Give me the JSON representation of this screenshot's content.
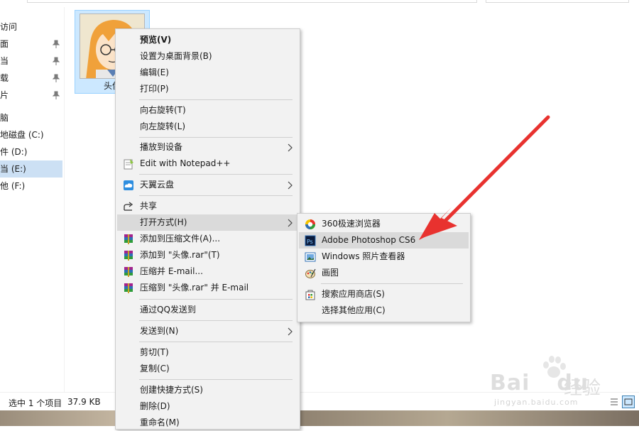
{
  "nav": {
    "items": [
      {
        "label": "访问",
        "pinned": false
      },
      {
        "label": "面",
        "pinned": true
      },
      {
        "label": "当",
        "pinned": true
      },
      {
        "label": "载",
        "pinned": true
      },
      {
        "label": "片",
        "pinned": true
      },
      {
        "label": "脑",
        "pinned": false
      },
      {
        "label": "地磁盘 (C:)",
        "pinned": false
      },
      {
        "label": "件 (D:)",
        "pinned": false
      },
      {
        "label": "当 (E:)",
        "pinned": false,
        "selected": true
      },
      {
        "label": "他 (F:)",
        "pinned": false
      }
    ]
  },
  "file": {
    "name": "头像"
  },
  "status": {
    "selection": "选中 1 个项目",
    "size": "37.9 KB"
  },
  "context_menu": {
    "items": [
      {
        "label": "预览(V)",
        "bold": true
      },
      {
        "label": "设置为桌面背景(B)"
      },
      {
        "label": "编辑(E)"
      },
      {
        "label": "打印(P)"
      },
      {
        "label": "向右旋转(T)"
      },
      {
        "label": "向左旋转(L)"
      },
      {
        "label": "播放到设备",
        "submenu": true
      },
      {
        "label": "Edit with Notepad++",
        "icon": "notepad-icon"
      },
      {
        "label": "天翼云盘",
        "icon": "cloud-icon",
        "submenu": true
      },
      {
        "label": "共享",
        "icon": "share-icon"
      },
      {
        "label": "打开方式(H)",
        "submenu": true,
        "highlighted": true
      },
      {
        "label": "添加到压缩文件(A)...",
        "icon": "winrar-icon"
      },
      {
        "label": "添加到 \"头像.rar\"(T)",
        "icon": "winrar-icon"
      },
      {
        "label": "压缩并 E-mail...",
        "icon": "winrar-icon"
      },
      {
        "label": "压缩到 \"头像.rar\" 并 E-mail",
        "icon": "winrar-icon"
      },
      {
        "label": "通过QQ发送到"
      },
      {
        "label": "发送到(N)",
        "submenu": true
      },
      {
        "label": "剪切(T)"
      },
      {
        "label": "复制(C)"
      },
      {
        "label": "创建快捷方式(S)"
      },
      {
        "label": "删除(D)"
      },
      {
        "label": "重命名(M)"
      }
    ]
  },
  "open_with_menu": {
    "items": [
      {
        "label": "360极速浏览器",
        "icon": "browser-360-icon"
      },
      {
        "label": "Adobe Photoshop CS6",
        "icon": "photoshop-icon",
        "highlighted": true
      },
      {
        "label": "Windows 照片查看器",
        "icon": "photo-viewer-icon"
      },
      {
        "label": "画图",
        "icon": "paint-icon"
      },
      {
        "label": "搜索应用商店(S)",
        "icon": "store-icon"
      },
      {
        "label": "选择其他应用(C)"
      }
    ]
  },
  "watermark": {
    "brand": "Bai",
    "brand2": "du",
    "cn": "经验",
    "url": "jingyan.baidu.com"
  },
  "colors": {
    "selection": "#cce8ff",
    "highlight": "#dadada",
    "menu_bg": "#f2f2f2",
    "annotation": "#e8322f"
  }
}
